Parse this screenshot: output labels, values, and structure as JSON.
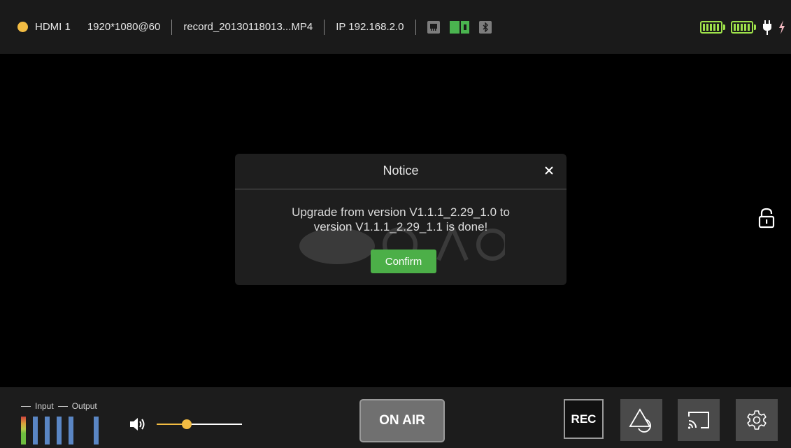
{
  "topbar": {
    "source_label": "HDMI 1",
    "resolution": "1920*1080@60",
    "record_file": "record_20130118013...MP4",
    "ip": "IP 192.168.2.0",
    "icons": [
      "ethernet-icon",
      "sd-card-icon",
      "bluetooth-icon"
    ],
    "batteries": [
      "battery-1-icon",
      "battery-2-icon"
    ],
    "power_icons": [
      "plug-icon",
      "charging-bolt-icon"
    ],
    "colors": {
      "source_dot": "#f2bc43",
      "sd_card": "#4ab44f",
      "battery": "#9ee14a"
    }
  },
  "modal": {
    "title": "Notice",
    "close_icon": "close-icon",
    "message_line1": "Upgrade from version V1.1.1_2.29_1.0 to",
    "message_line2": "version V1.1.1_2.29_1.1 is done!",
    "confirm_label": "Confirm",
    "confirm_color": "#4caf48"
  },
  "side": {
    "lock_icon": "unlock-icon"
  },
  "bottombar": {
    "legend_input": "Input",
    "legend_output": "Output",
    "volume_level": 0.35,
    "volume_color": "#f2bc43",
    "onair_label": "ON AIR",
    "rec_label": "REC",
    "buttons": [
      "stream-icon",
      "cast-icon",
      "settings-icon"
    ]
  }
}
